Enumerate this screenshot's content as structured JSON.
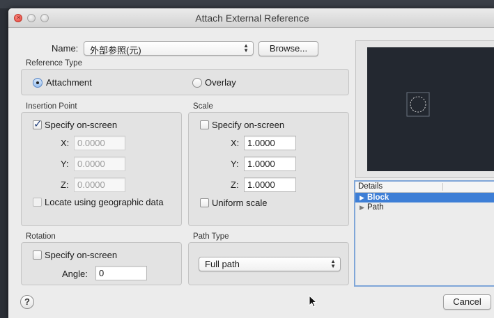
{
  "window": {
    "title": "Attach External Reference"
  },
  "name_row": {
    "label": "Name:",
    "value": "外部参照(元)",
    "browse_label": "Browse..."
  },
  "reference_type": {
    "label": "Reference Type",
    "attachment": "Attachment",
    "overlay": "Overlay",
    "selected": "Attachment"
  },
  "insertion_point": {
    "label": "Insertion Point",
    "specify_label": "Specify on-screen",
    "specify_checked": true,
    "x_label": "X:",
    "x_value": "0.0000",
    "y_label": "Y:",
    "y_value": "0.0000",
    "z_label": "Z:",
    "z_value": "0.0000",
    "geo_label": "Locate using geographic data"
  },
  "scale": {
    "label": "Scale",
    "specify_label": "Specify on-screen",
    "specify_checked": false,
    "x_label": "X:",
    "x_value": "1.0000",
    "y_label": "Y:",
    "y_value": "1.0000",
    "z_label": "Z:",
    "z_value": "1.0000",
    "uniform_label": "Uniform scale"
  },
  "rotation": {
    "label": "Rotation",
    "specify_label": "Specify on-screen",
    "angle_label": "Angle:",
    "angle_value": "0"
  },
  "path_type": {
    "label": "Path Type",
    "value": "Full path"
  },
  "details": {
    "header": "Details",
    "rows": [
      "Block",
      "Path"
    ],
    "selected": "Block"
  },
  "footer": {
    "help_label": "?",
    "cancel_label": "Cancel"
  },
  "colors": {
    "dialog_bg": "#ececec",
    "preview_bg": "#232830",
    "selection": "#3d7ed6",
    "close_button": "#e0443e"
  }
}
